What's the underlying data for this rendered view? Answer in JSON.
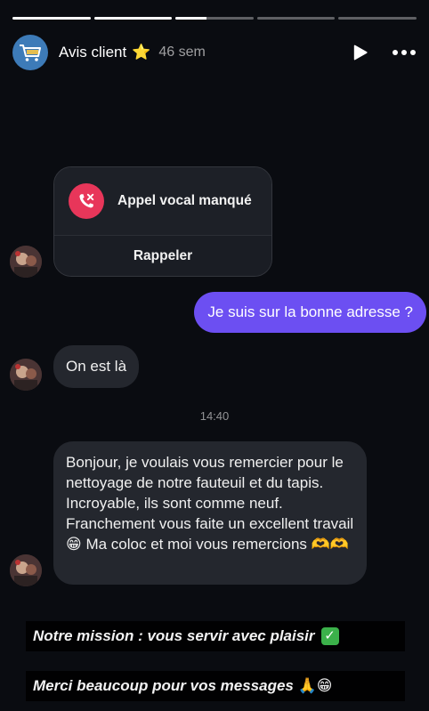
{
  "story": {
    "progress": [
      1,
      1,
      0.4,
      0,
      0
    ],
    "account_name": "Avis client",
    "account_star": "⭐",
    "age": "46 sem"
  },
  "icons": {
    "avatar": "shopping-cart-logo-icon",
    "play": "play-icon",
    "more": "more-horizontal-icon",
    "missed_call": "missed-call-icon"
  },
  "chat": {
    "missed_call_label": "Appel vocal manqué",
    "callback_label": "Rappeler",
    "outgoing_message": "Je suis sur la bonne adresse ?",
    "incoming_message_1": "On est là",
    "timestamp": "14:40",
    "incoming_message_2": "Bonjour, je voulais vous remercier pour le nettoyage de notre fauteuil et du tapis. Incroyable, ils sont comme neuf. Franchement vous faite un excellent travail 😁 Ma coloc et moi vous remercions 🫶🫶"
  },
  "captions": {
    "line1": "Notre mission : vous servir avec plaisir",
    "line1_emoji": "✅",
    "line2": "Merci beaucoup pour vos messages",
    "line2_emoji": "🙏😁"
  },
  "colors": {
    "outgoing_bubble": "#6c4ff2",
    "incoming_bubble": "#24272e",
    "missed_call_red": "#e8365a",
    "background": "#0a0c11"
  }
}
